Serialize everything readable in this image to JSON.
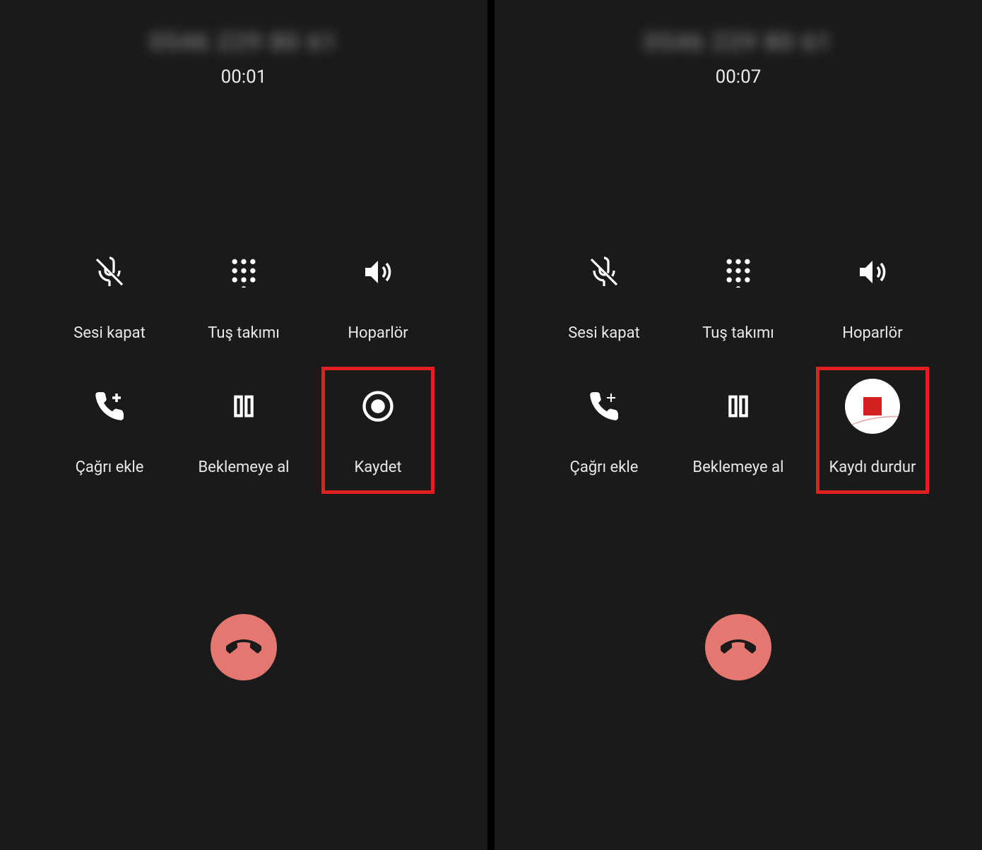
{
  "panes": [
    {
      "caller_display": "0546 229 80 61",
      "timer": "00:01",
      "buttons": {
        "mute": "Sesi kapat",
        "keypad": "Tuş takımı",
        "speaker": "Hoparlör",
        "add_call": "Çağrı ekle",
        "hold": "Beklemeye al",
        "record": "Kaydet"
      },
      "record_active": false,
      "highlight_record": true
    },
    {
      "caller_display": "0546 229 80 61",
      "timer": "00:07",
      "buttons": {
        "mute": "Sesi kapat",
        "keypad": "Tuş takımı",
        "speaker": "Hoparlör",
        "add_call": "Çağrı ekle",
        "hold": "Beklemeye al",
        "record": "Kaydı durdur"
      },
      "record_active": true,
      "highlight_record": true
    }
  ],
  "colors": {
    "bg": "#1a1a1a",
    "highlight": "#e02020",
    "end_call": "#e47870"
  }
}
